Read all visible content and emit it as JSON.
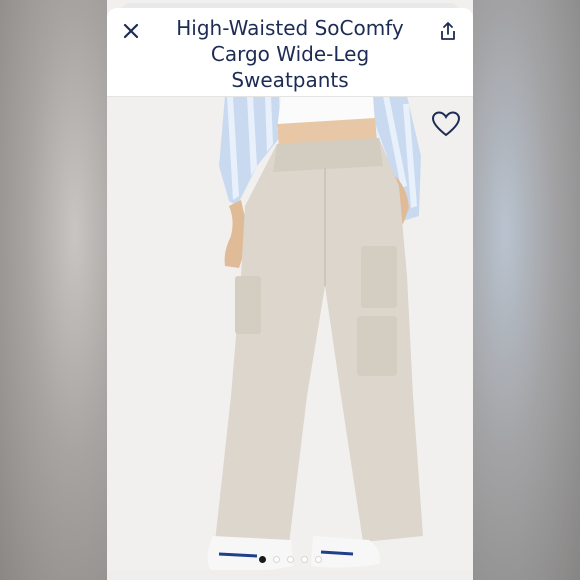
{
  "header": {
    "title": "High-Waisted SoComfy Cargo Wide-Leg Sweatpants",
    "close_icon": "close-icon",
    "share_icon": "share-icon"
  },
  "product_image": {
    "favorite_icon": "heart-outline-icon"
  },
  "carousel": {
    "total_dots": 5,
    "active_index": 0
  },
  "colors": {
    "title_color": "#1d2c55",
    "background": "#f1f0ee"
  }
}
